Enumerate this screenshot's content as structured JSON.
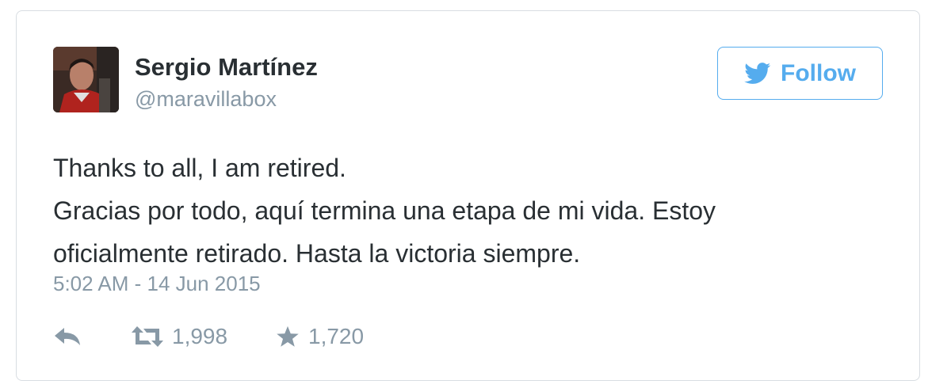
{
  "tweet": {
    "author": {
      "display_name": "Sergio Martínez",
      "handle": "@maravillabox"
    },
    "follow_button": {
      "label": "Follow",
      "icon": "twitter-bird-icon"
    },
    "text_lines": [
      "Thanks to all, I am retired.",
      "Gracias por todo, aquí termina una etapa de mi vida. Estoy",
      "oficialmente retirado. Hasta la victoria siempre."
    ],
    "timestamp": "5:02 AM - 14 Jun 2015",
    "actions": {
      "reply": {
        "icon": "reply-icon"
      },
      "retweet": {
        "icon": "retweet-icon",
        "count": "1,998"
      },
      "favorite": {
        "icon": "star-icon",
        "count": "1,720"
      }
    }
  },
  "colors": {
    "accent": "#55acee",
    "text": "#292f33",
    "muted": "#8899a6",
    "border": "#d8dde2"
  }
}
